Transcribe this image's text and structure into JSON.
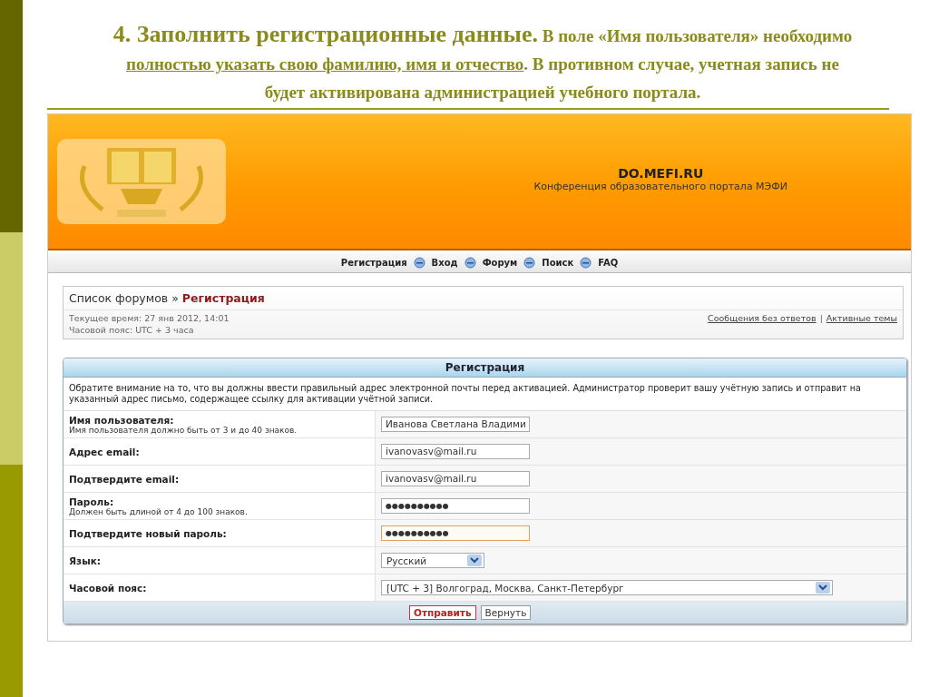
{
  "slide": {
    "lead": "4. Заполнить регистрационные данные.",
    "text_before": " В поле «Имя пользователя» необходимо ",
    "underlined": "полностью указать свою фамилию, имя и отчество",
    "text_after": ". В противном случае, учетная запись не будет активирована администрацией учебного портала."
  },
  "site": {
    "title": "DO.MEFI.RU",
    "subtitle": "Конференция образовательного портала МЭФИ"
  },
  "nav": [
    "Регистрация",
    "Вход",
    "Форум",
    "Поиск",
    "FAQ"
  ],
  "breadcrumb": {
    "root": "Список форумов",
    "separator": "»",
    "current": "Регистрация"
  },
  "info": {
    "time": "Текущее время: 27 янв 2012, 14:01",
    "timezone": "Часовой пояс: UTC + 3 часа",
    "links": [
      "Сообщения без ответов",
      "Активные темы"
    ],
    "link_separator": "|"
  },
  "panel": {
    "title": "Регистрация",
    "notice": "Обратите внимание на то, что вы должны ввести правильный адрес электронной почты перед активацией. Администратор проверит вашу учётную запись и отправит на указанный адрес письмо, содержащее ссылку для активации учётной записи.",
    "rows": [
      {
        "label": "Имя пользователя:",
        "hint": "Имя пользователя должно быть от 3 и до 40 знаков.",
        "kind": "text",
        "value": "Иванова Светлана Владими",
        "focused": false
      },
      {
        "label": "Адрес email:",
        "kind": "text",
        "value": "ivanovasv@mail.ru",
        "focused": false
      },
      {
        "label": "Подтвердите email:",
        "kind": "text",
        "value": "ivanovasv@mail.ru",
        "focused": false
      },
      {
        "label": "Пароль:",
        "hint": "Должен быть длиной от 4 до 100 знаков.",
        "kind": "password",
        "value": "●●●●●●●●●●",
        "focused": false
      },
      {
        "label": "Подтвердите новый пароль:",
        "kind": "password",
        "value": "●●●●●●●●●●",
        "focused": true
      },
      {
        "label": "Язык:",
        "kind": "select",
        "value": "Русский",
        "focused": false
      },
      {
        "label": "Часовой пояс:",
        "kind": "wide-select",
        "value": "[UTC + 3] Волгоград, Москва, Санкт-Петербург",
        "focused": false
      }
    ],
    "buttons": [
      {
        "label": "Отправить",
        "kind": "primary"
      },
      {
        "label": "Вернуть",
        "kind": "secondary"
      }
    ]
  }
}
